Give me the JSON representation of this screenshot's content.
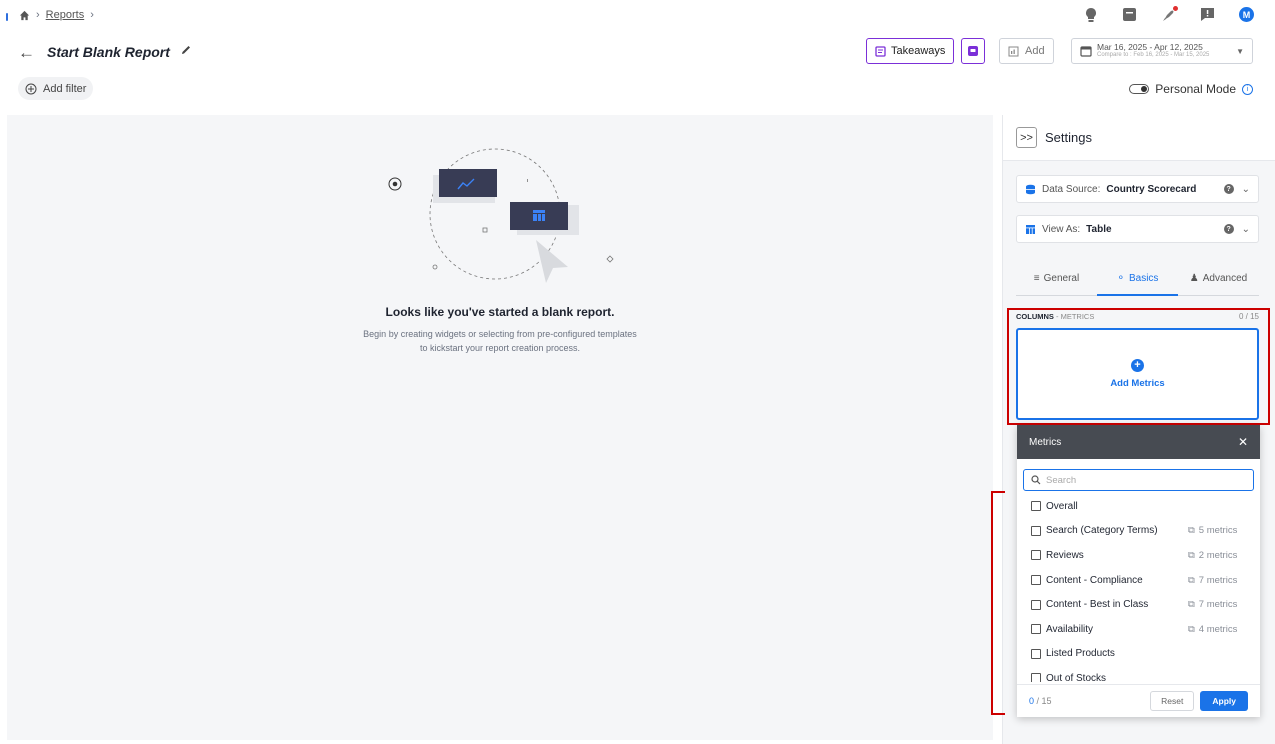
{
  "breadcrumb": {
    "items": [
      "Reports"
    ]
  },
  "header": {
    "title": "Start Blank Report",
    "takeaways_label": "Takeaways",
    "add_label": "Add",
    "date_range": "Mar 16, 2025 - Apr 12, 2025",
    "compare_text": "Compare to : Feb 16, 2025 - Mar 15, 2025",
    "avatar_initial": "M"
  },
  "filters": {
    "add_filter_label": "Add filter",
    "personal_mode_label": "Personal Mode"
  },
  "empty_state": {
    "title": "Looks like you've started a blank report.",
    "subtitle_line1": "Begin by creating widgets or selecting from pre-configured templates",
    "subtitle_line2": "to kickstart your report creation process."
  },
  "settings": {
    "title": "Settings",
    "data_source_label": "Data Source:",
    "data_source_value": "Country Scorecard",
    "view_as_label": "View As:",
    "view_as_value": "Table",
    "tabs": [
      {
        "label": "General"
      },
      {
        "label": "Basics"
      },
      {
        "label": "Advanced"
      }
    ],
    "columns_label": "COLUMNS",
    "columns_sub": " - METRICS",
    "columns_count": "0 / 15",
    "add_metrics_label": "Add Metrics"
  },
  "metrics_dropdown": {
    "title": "Metrics",
    "search_placeholder": "Search",
    "items": [
      {
        "label": "Overall",
        "count": ""
      },
      {
        "label": "Search (Category Terms)",
        "count": "5 metrics"
      },
      {
        "label": "Reviews",
        "count": "2 metrics"
      },
      {
        "label": "Content - Compliance",
        "count": "7 metrics"
      },
      {
        "label": "Content - Best in Class",
        "count": "7 metrics"
      },
      {
        "label": "Availability",
        "count": "4 metrics"
      },
      {
        "label": "Listed Products",
        "count": ""
      },
      {
        "label": "Out of Stocks",
        "count": ""
      }
    ],
    "selected": "0",
    "selected_total": " / 15",
    "reset_label": "Reset",
    "apply_label": "Apply"
  },
  "colors": {
    "accent": "#1a73e8",
    "brand_purple": "#7b2fd8",
    "highlight_red": "#cc0000",
    "dropdown_header": "#474b52"
  }
}
